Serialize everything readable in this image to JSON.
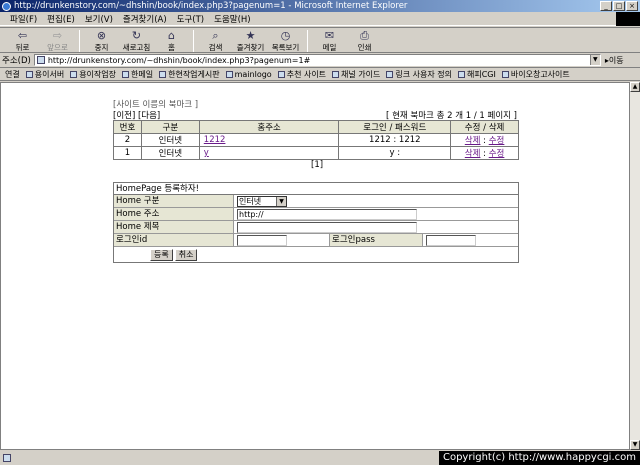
{
  "window": {
    "title": "http://drunkenstory.com/~dhshin/book/index.php3?pagenum=1 - Microsoft Internet Explorer",
    "min": "_",
    "max": "□",
    "close": "×"
  },
  "menu": [
    "파일(F)",
    "편집(E)",
    "보기(V)",
    "즐겨찾기(A)",
    "도구(T)",
    "도움말(H)"
  ],
  "toolbar": [
    {
      "label": "뒤로",
      "icon": "back-arrow-icon",
      "glyph": "⇦",
      "enabled": true
    },
    {
      "label": "앞으로",
      "icon": "forward-arrow-icon",
      "glyph": "⇨",
      "enabled": false
    },
    {
      "label": "중지",
      "icon": "stop-icon",
      "glyph": "⊗",
      "enabled": true
    },
    {
      "label": "새로고침",
      "icon": "refresh-icon",
      "glyph": "↻",
      "enabled": true
    },
    {
      "label": "홈",
      "icon": "home-icon",
      "glyph": "⌂",
      "enabled": true
    },
    {
      "label": "검색",
      "icon": "search-icon",
      "glyph": "⌕",
      "enabled": true
    },
    {
      "label": "즐겨찾기",
      "icon": "favorites-icon",
      "glyph": "★",
      "enabled": true
    },
    {
      "label": "목록보기",
      "icon": "history-icon",
      "glyph": "◷",
      "enabled": true
    },
    {
      "label": "메일",
      "icon": "mail-icon",
      "glyph": "✉",
      "enabled": true
    },
    {
      "label": "인쇄",
      "icon": "print-icon",
      "glyph": "⎙",
      "enabled": true
    }
  ],
  "address": {
    "label": "주소(D)",
    "value": "http://drunkenstory.com/~dhshin/book/index.php3?pagenum=1#",
    "go": "이동"
  },
  "links": {
    "label": "연결",
    "items": [
      "용이서버",
      "용이작업장",
      "한메일",
      "한현작업게시판",
      "mainlogo",
      "추천 사이트",
      "채널 가이드",
      "링크 사용자 정의",
      "해피CGI",
      "바이오창고사이트"
    ]
  },
  "page": {
    "site_title": "[사이트 이름의 북마크 ]",
    "nav": "[이전] [다음]",
    "count_info": "[ 현재 북마크 총 2 개 1 / 1 페이지 ]",
    "table": {
      "headers": [
        "번호",
        "구분",
        "홈주소",
        "로그인 / 패스워드",
        "수정 / 삭제"
      ],
      "rows": [
        {
          "no": "2",
          "category": "인터넷",
          "url": "1212",
          "login": "1212 : 1212",
          "del": "삭제",
          "sep": " : ",
          "edit": "수정"
        },
        {
          "no": "1",
          "category": "인터넷",
          "url": "y",
          "login": "y :",
          "del": "삭제",
          "sep": " : ",
          "edit": "수정"
        }
      ]
    },
    "pager": "[1]",
    "form": {
      "title": "HomePage 등록하자!",
      "category_label": "Home 구분",
      "category_value": "인터넷",
      "address_label": "Home 주소",
      "address_value": "http://",
      "name_label": "Home 제목",
      "name_value": "",
      "login_label": "로그인id",
      "login_value": "",
      "pass_label": "로그인pass",
      "pass_value": "",
      "submit": "등록",
      "cancel": "취소"
    }
  },
  "status": {
    "copyright": "Copyright(c) http://www.happycgi.com"
  }
}
